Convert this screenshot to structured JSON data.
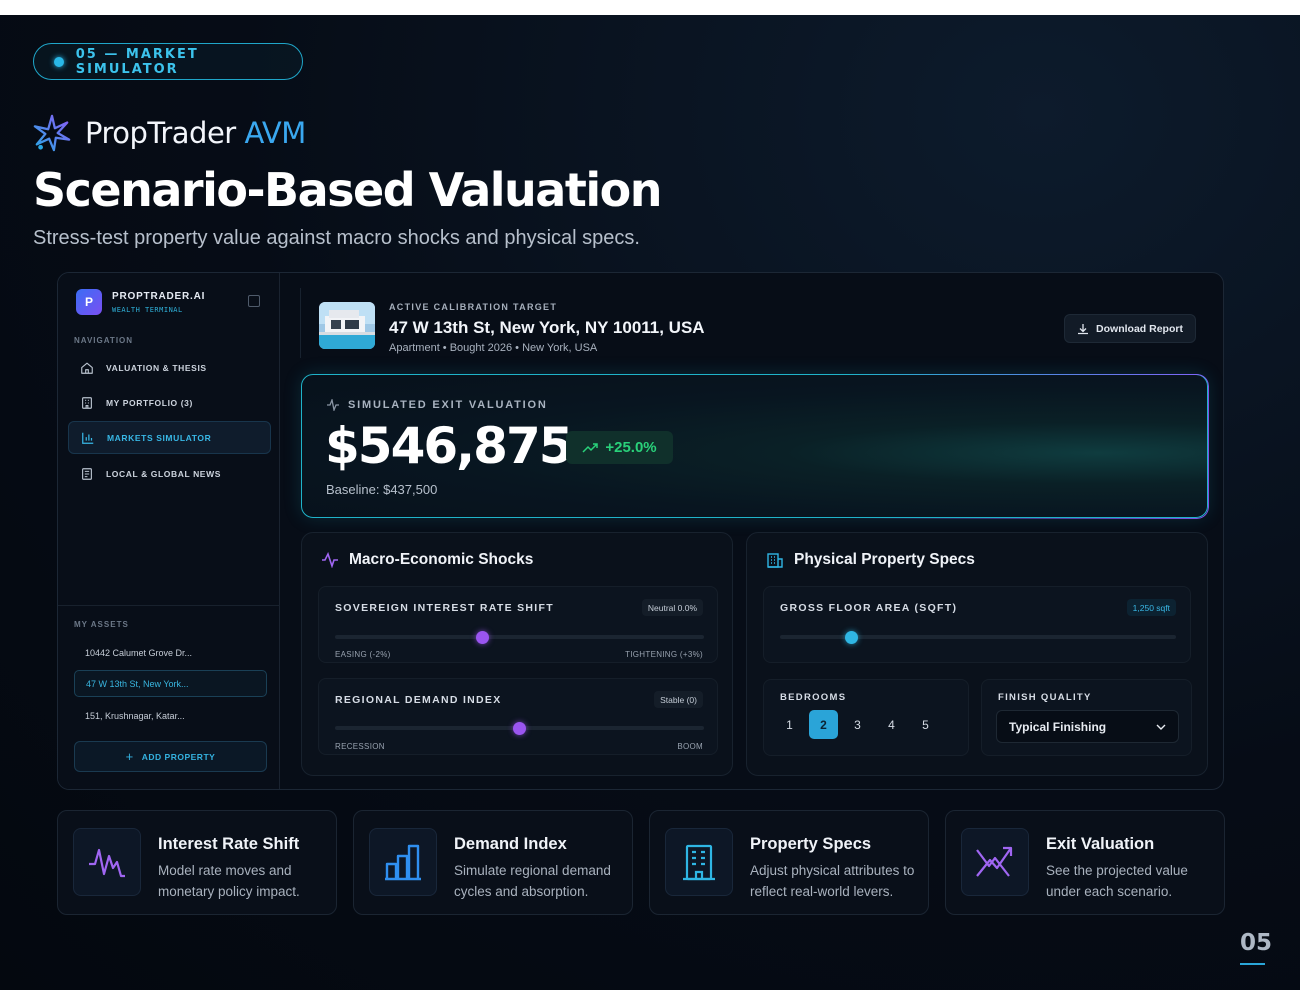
{
  "header": {
    "pill_label": "05 — MARKET SIMULATOR",
    "brand_name": "PropTrader",
    "brand_accent": "AVM",
    "headline": "Scenario-Based Valuation",
    "subline": "Stress-test property value against macro shocks and physical specs."
  },
  "sidebar": {
    "brand_title": "PROPTRADER.AI",
    "brand_subtitle": "WEALTH TERMINAL",
    "logo_letter": "P",
    "nav_heading": "NAVIGATION",
    "nav_items": [
      {
        "label": "VALUATION & THESIS",
        "icon": "home-icon"
      },
      {
        "label": "MY PORTFOLIO (3)",
        "icon": "building-icon"
      },
      {
        "label": "MARKETS SIMULATOR",
        "icon": "bar-chart-icon",
        "active": true
      },
      {
        "label": "LOCAL & GLOBAL NEWS",
        "icon": "newspaper-icon"
      }
    ],
    "assets_heading": "MY ASSETS",
    "assets": [
      {
        "label": "10442 Calumet Grove Dr..."
      },
      {
        "label": "47 W 13th St, New York...",
        "active": true
      },
      {
        "label": "151, Krushnagar, Katar..."
      }
    ],
    "add_property": "ADD PROPERTY"
  },
  "target": {
    "label": "ACTIVE CALIBRATION TARGET",
    "address": "47 W 13th St, New York, NY 10011, USA",
    "meta": "Apartment • Bought 2026 • New York, USA",
    "download_label": "Download Report"
  },
  "valuation": {
    "label": "SIMULATED EXIT VALUATION",
    "value": "$546,875",
    "change": "+25.0%",
    "baseline": "Baseline: $437,500"
  },
  "macro": {
    "title": "Macro-Economic Shocks",
    "interest": {
      "title": "SOVEREIGN INTEREST RATE SHIFT",
      "tag": "Neutral 0.0%",
      "min_label": "EASING (-2%)",
      "max_label": "TIGHTENING (+3%)",
      "min": -2,
      "max": 3,
      "value": 0
    },
    "demand": {
      "title": "REGIONAL DEMAND INDEX",
      "tag": "Stable (0)",
      "min_label": "RECESSION",
      "max_label": "BOOM",
      "position": 0.5
    }
  },
  "physical": {
    "title": "Physical Property Specs",
    "area": {
      "title": "GROSS FLOOR AREA (SQFT)",
      "tag": "1,250 sqft",
      "position": 0.18
    },
    "bedrooms": {
      "title": "BEDROOMS",
      "options": [
        "1",
        "2",
        "3",
        "4",
        "5"
      ],
      "selected": "2"
    },
    "finish": {
      "title": "FINISH QUALITY",
      "selected": "Typical Finishing"
    }
  },
  "features": [
    {
      "title": "Interest Rate Shift",
      "desc": "Model rate moves and monetary policy impact.",
      "icon": "pulse-icon"
    },
    {
      "title": "Demand Index",
      "desc": "Simulate regional demand cycles and absorption.",
      "icon": "bar-chart-icon"
    },
    {
      "title": "Property Specs",
      "desc": "Adjust physical attributes to reflect real-world levers.",
      "icon": "building-icon"
    },
    {
      "title": "Exit Valuation",
      "desc": "See the projected value under each scenario.",
      "icon": "trend-up-icon"
    }
  ],
  "page_number": "05",
  "colors": {
    "accent": "#2fb6e4",
    "purple": "#9a55f0",
    "positive": "#29d17a",
    "background": "#060c16"
  }
}
